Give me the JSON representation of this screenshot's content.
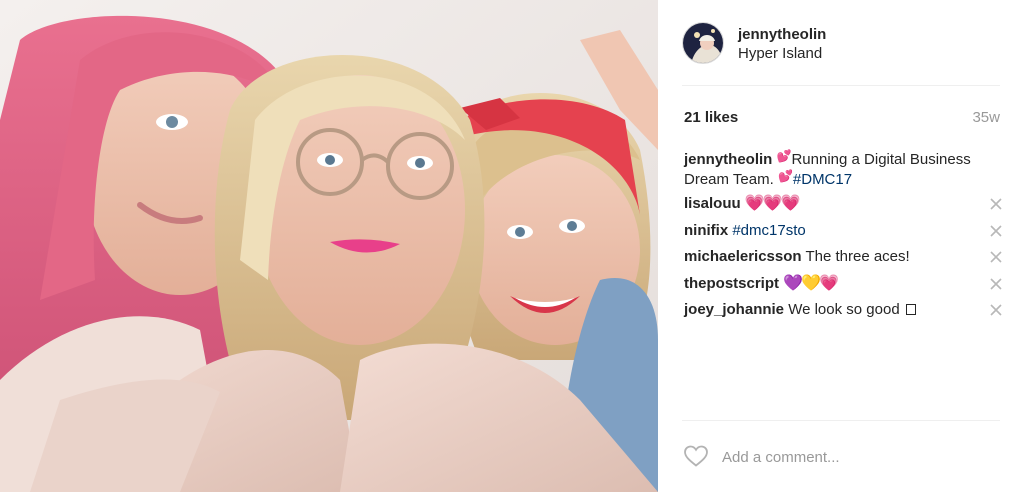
{
  "post": {
    "username": "jennytheolin",
    "location": "Hyper Island",
    "likes": "21 likes",
    "age": "35w",
    "caption": {
      "user": "jennytheolin",
      "text_1": "Running a Digital Business Dream Team.",
      "hashtag": "#DMC17"
    }
  },
  "comments": [
    {
      "user": "lisalouu",
      "text": "",
      "hearts": "💗💗💗"
    },
    {
      "user": "ninifix",
      "text": "",
      "hashtag": "#dmc17sto"
    },
    {
      "user": "michaelericsson",
      "text": "The three aces!"
    },
    {
      "user": "thepostscript",
      "text": "",
      "hearts": "💜💛💗"
    },
    {
      "user": "joey_johannie",
      "text": "We look so good"
    }
  ],
  "add_comment": {
    "placeholder": "Add a comment..."
  },
  "colors": {
    "accent_pink": "#f25aa8",
    "hashtag_blue": "#003569",
    "muted": "#999999"
  },
  "icons": [
    "heart-outline-icon",
    "close-icon"
  ]
}
